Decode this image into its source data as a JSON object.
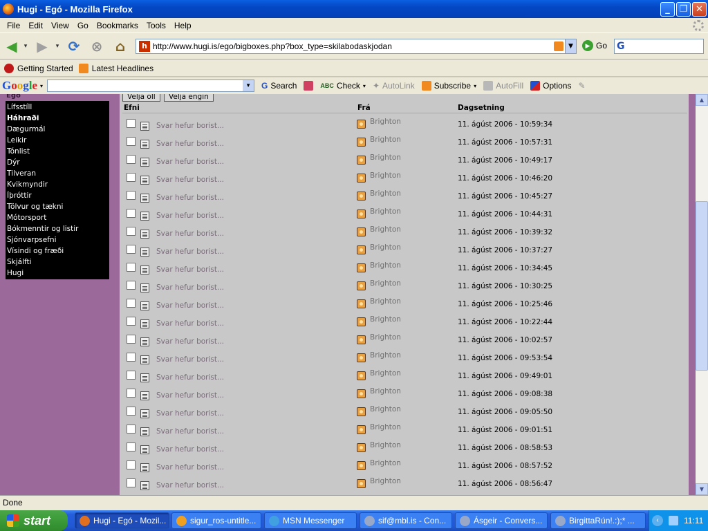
{
  "window": {
    "title": "Hugi - Egó - Mozilla Firefox",
    "min": "_",
    "max": "❐",
    "close": "✕"
  },
  "menu": [
    "File",
    "Edit",
    "View",
    "Go",
    "Bookmarks",
    "Tools",
    "Help"
  ],
  "nav": {
    "url": "http://www.hugi.is/ego/bigboxes.php?box_type=skilabodaskjodan",
    "go_label": "Go"
  },
  "bookmarks": [
    "Getting Started",
    "Latest Headlines"
  ],
  "google_toolbar": {
    "search_label": "Search",
    "check_label": "Check",
    "autolink_label": "AutoLink",
    "subscribe_label": "Subscribe",
    "autofill_label": "AutoFill",
    "options_label": "Options"
  },
  "sidebar": {
    "section": "Egó",
    "categories": [
      "Lífsstíll",
      "Háhraði",
      "Dægurmál",
      "Leikir",
      "Tónlist",
      "Dýr",
      "Tilveran",
      "Kvikmyndir",
      "Íþróttir",
      "Tölvur og tækni",
      "Mótorsport",
      "Bókmenntir og listir",
      "Sjónvarpsefni",
      "Vísindi og fræði",
      "Skjálfti",
      "Hugi"
    ],
    "active": "Háhraði"
  },
  "messages": {
    "select_all": "Velja öll",
    "select_none": "Velja engin",
    "col_subject": "Efni",
    "col_from": "Frá",
    "col_date": "Dagsetning",
    "rows": [
      {
        "subject": "Svar hefur borist...",
        "from": "Brighton",
        "date": "11. ágúst 2006 - 10:59:34"
      },
      {
        "subject": "Svar hefur borist...",
        "from": "Brighton",
        "date": "11. ágúst 2006 - 10:57:31"
      },
      {
        "subject": "Svar hefur borist...",
        "from": "Brighton",
        "date": "11. ágúst 2006 - 10:49:17"
      },
      {
        "subject": "Svar hefur borist...",
        "from": "Brighton",
        "date": "11. ágúst 2006 - 10:46:20"
      },
      {
        "subject": "Svar hefur borist...",
        "from": "Brighton",
        "date": "11. ágúst 2006 - 10:45:27"
      },
      {
        "subject": "Svar hefur borist...",
        "from": "Brighton",
        "date": "11. ágúst 2006 - 10:44:31"
      },
      {
        "subject": "Svar hefur borist...",
        "from": "Brighton",
        "date": "11. ágúst 2006 - 10:39:32"
      },
      {
        "subject": "Svar hefur borist...",
        "from": "Brighton",
        "date": "11. ágúst 2006 - 10:37:27"
      },
      {
        "subject": "Svar hefur borist...",
        "from": "Brighton",
        "date": "11. ágúst 2006 - 10:34:45"
      },
      {
        "subject": "Svar hefur borist...",
        "from": "Brighton",
        "date": "11. ágúst 2006 - 10:30:25"
      },
      {
        "subject": "Svar hefur borist...",
        "from": "Brighton",
        "date": "11. ágúst 2006 - 10:25:46"
      },
      {
        "subject": "Svar hefur borist...",
        "from": "Brighton",
        "date": "11. ágúst 2006 - 10:22:44"
      },
      {
        "subject": "Svar hefur borist...",
        "from": "Brighton",
        "date": "11. ágúst 2006 - 10:02:57"
      },
      {
        "subject": "Svar hefur borist...",
        "from": "Brighton",
        "date": "11. ágúst 2006 - 09:53:54"
      },
      {
        "subject": "Svar hefur borist...",
        "from": "Brighton",
        "date": "11. ágúst 2006 - 09:49:01"
      },
      {
        "subject": "Svar hefur borist...",
        "from": "Brighton",
        "date": "11. ágúst 2006 - 09:08:38"
      },
      {
        "subject": "Svar hefur borist...",
        "from": "Brighton",
        "date": "11. ágúst 2006 - 09:05:50"
      },
      {
        "subject": "Svar hefur borist...",
        "from": "Brighton",
        "date": "11. ágúst 2006 - 09:01:51"
      },
      {
        "subject": "Svar hefur borist...",
        "from": "Brighton",
        "date": "11. ágúst 2006 - 08:58:53"
      },
      {
        "subject": "Svar hefur borist...",
        "from": "Brighton",
        "date": "11. ágúst 2006 - 08:57:52"
      },
      {
        "subject": "Svar hefur borist...",
        "from": "Brighton",
        "date": "11. ágúst 2006 - 08:56:47"
      }
    ]
  },
  "status": "Done",
  "taskbar": {
    "start": "start",
    "items": [
      {
        "label": "Hugi - Egó - Mozil...",
        "icon": "firefox-icon",
        "color": "#e07020"
      },
      {
        "label": "sigur_ros-untitle...",
        "icon": "media-player-icon",
        "color": "#f0a020"
      },
      {
        "label": "MSN Messenger",
        "icon": "msn-icon",
        "color": "#40a0e0"
      },
      {
        "label": "sif@mbl.is - Con...",
        "icon": "msn-chat-icon",
        "color": "#9aa8c8"
      },
      {
        "label": "Ásgeir - Convers...",
        "icon": "msn-chat-icon",
        "color": "#9aa8c8"
      },
      {
        "label": "BirgittaRún!.:);* ...",
        "icon": "msn-chat-icon",
        "color": "#9aa8c8"
      }
    ],
    "clock": "11:11"
  }
}
